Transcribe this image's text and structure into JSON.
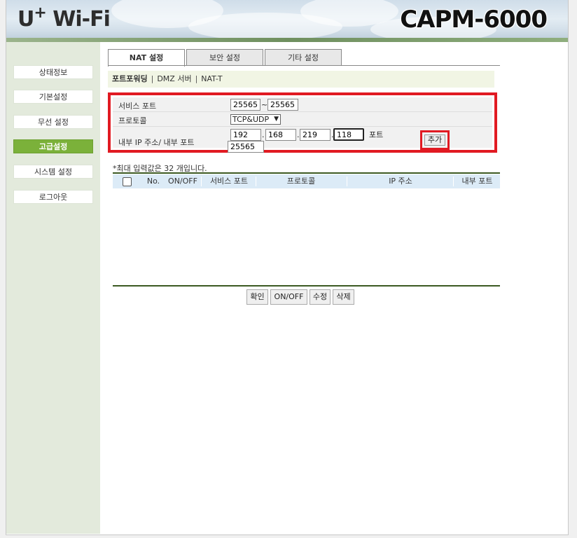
{
  "header": {
    "logo_u": "U",
    "logo_plus": "+",
    "logo_wifi": "Wi-Fi",
    "model": "CAPM-6000"
  },
  "sidebar": {
    "items": [
      {
        "label": "상태정보"
      },
      {
        "label": "기본설정"
      },
      {
        "label": "무선 설정"
      },
      {
        "label": "고급설정",
        "active": true
      },
      {
        "label": "시스템 설정"
      },
      {
        "label": "로그아웃"
      }
    ]
  },
  "tabs": [
    {
      "label": "NAT 설정",
      "active": true
    },
    {
      "label": "보안 설정"
    },
    {
      "label": "기타 설정"
    }
  ],
  "subnav": {
    "items": [
      "포트포워딩",
      "DMZ 서버",
      "NAT-T"
    ],
    "separator": "|"
  },
  "form": {
    "service_port_label": "서비스 포트",
    "service_port_start": "25565",
    "service_port_tilde": "~",
    "service_port_end": "25565",
    "protocol_label": "프로토콜",
    "protocol_value": "TCP&UDP",
    "internal_label": "내부 IP 주소/ 내부 포트",
    "ip1": "192",
    "ip2": "168",
    "ip3": "219",
    "ip4": "118",
    "ip_dot": ".",
    "port_word": "포트",
    "internal_port": "25565",
    "add_button": "추가"
  },
  "table": {
    "note": "*최대 입력값은 32 개입니다.",
    "headers": [
      "No.",
      "ON/OFF",
      "서비스 포트",
      "프로토콜",
      "IP 주소",
      "내부 포트"
    ],
    "rows": []
  },
  "actions": {
    "confirm": "확인",
    "onoff": "ON/OFF",
    "edit": "수정",
    "delete": "삭제"
  },
  "colors": {
    "accent_green": "#7bb13a",
    "highlight_red": "#e11a22",
    "table_header": "#dcebf7",
    "sidebar_bg": "#e3eadc"
  }
}
